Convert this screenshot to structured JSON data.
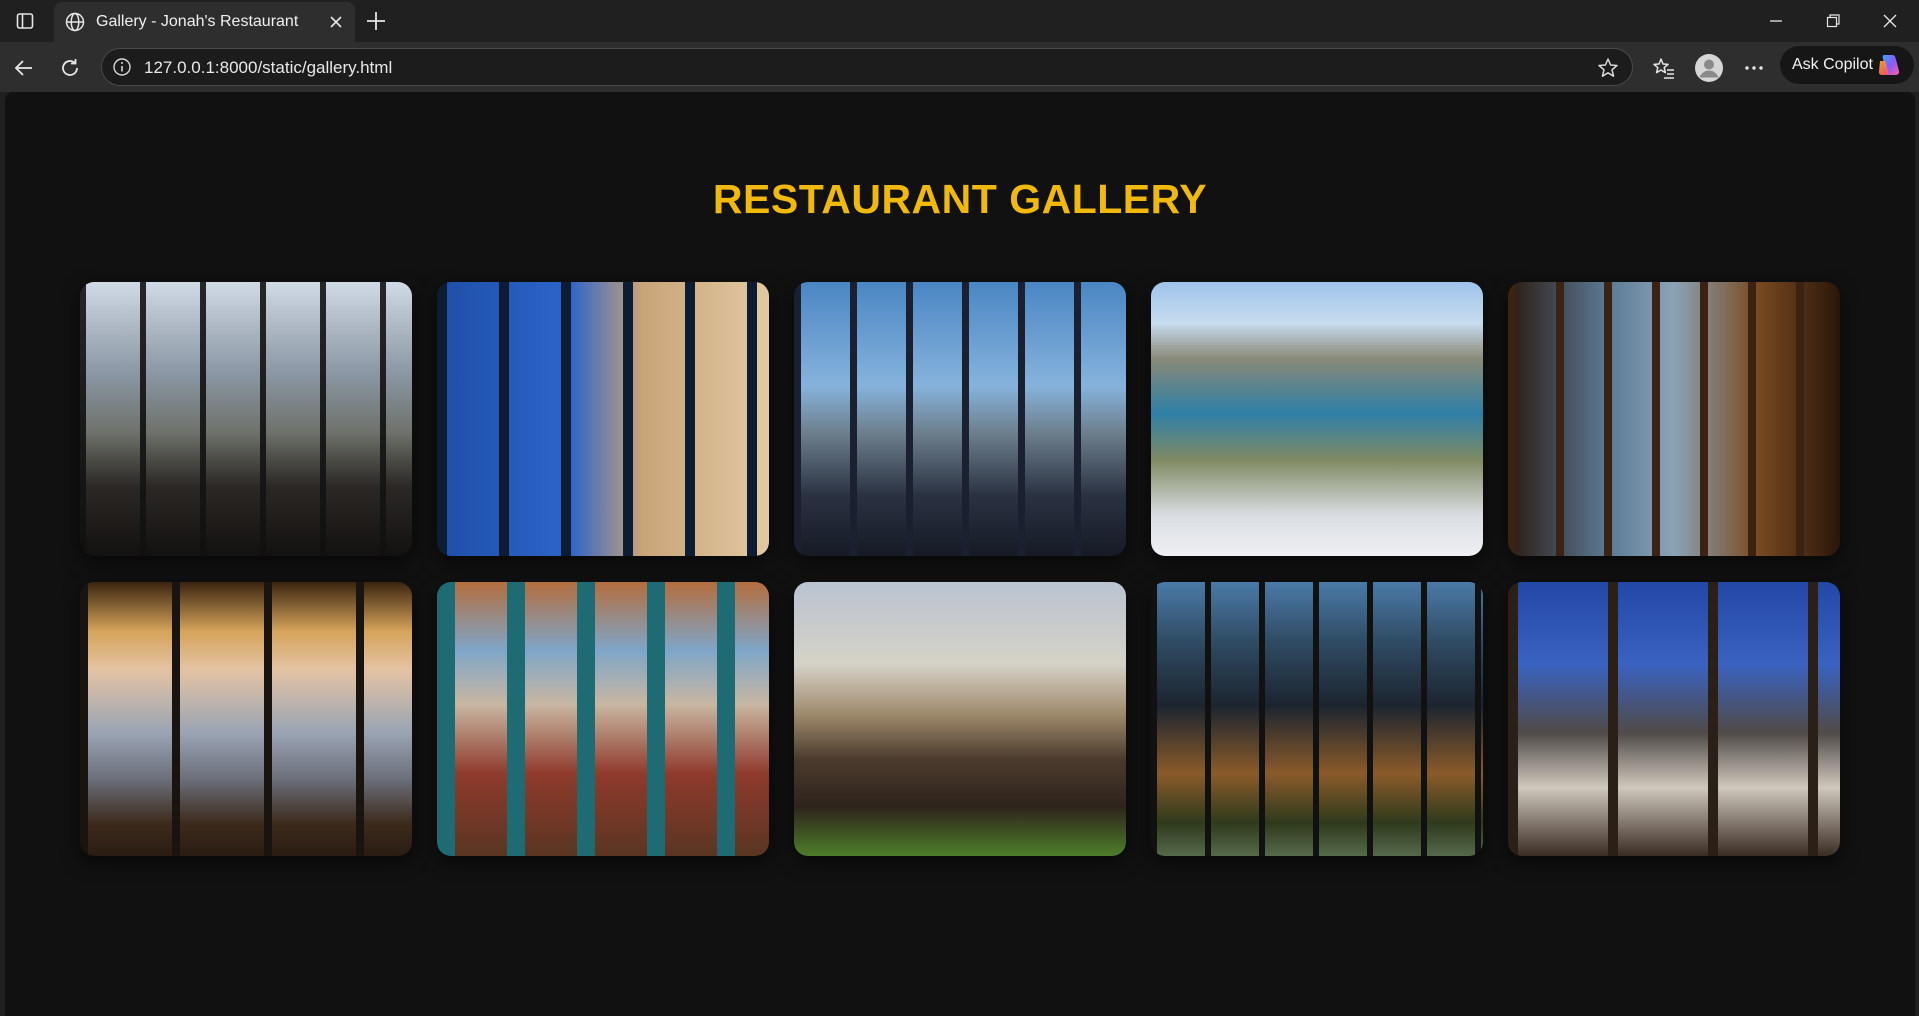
{
  "browser": {
    "tab_title": "Gallery - Jonah's Restaurant",
    "url": "127.0.0.1:8000/static/gallery.html",
    "copilot_label": "Ask Copilot",
    "icons": [
      "tab-actions-icon",
      "globe-icon",
      "close-icon",
      "plus-icon",
      "minimize-icon",
      "restore-icon",
      "window-close-icon",
      "back-icon",
      "refresh-icon",
      "info-icon",
      "star-icon",
      "favorites-icon",
      "profile-icon",
      "more-icon",
      "copilot-icon"
    ]
  },
  "page": {
    "title": "RESTAURANT GALLERY",
    "accent_color": "#f0b90b",
    "background_color": "#111111",
    "gallery": [
      {
        "id": 1
      },
      {
        "id": 2
      },
      {
        "id": 3
      },
      {
        "id": 4
      },
      {
        "id": 5
      },
      {
        "id": 6
      },
      {
        "id": 7
      },
      {
        "id": 8
      },
      {
        "id": 9
      },
      {
        "id": 10
      }
    ]
  }
}
